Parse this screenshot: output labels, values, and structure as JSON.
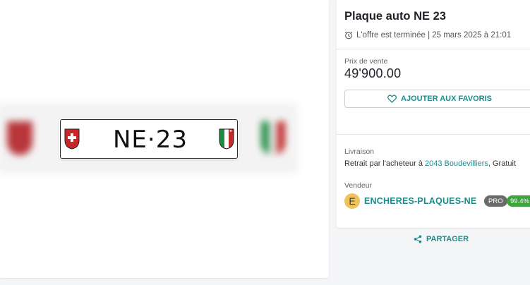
{
  "listing": {
    "plate_number": "NE·23",
    "title": "Plaque auto NE 23",
    "status": "L'offre est terminée | 25 mars 2025 à 21:01",
    "price_label": "Prix de vente",
    "price": "49'900.00",
    "favorite_label": "AJOUTER AUX FAVORIS"
  },
  "delivery": {
    "label": "Livraison",
    "text_prefix": "Retrait par l'acheteur à ",
    "location": "2043 Boudevilliers",
    "text_suffix": ", Gratuit"
  },
  "seller": {
    "label": "Vendeur",
    "initial": "E",
    "name": "ENCHERES-PLAQUES-NE",
    "pro_badge": "PRO",
    "rating": "99.4%"
  },
  "actions": {
    "share_label": "PARTAGER"
  },
  "colors": {
    "accent": "#1e8a8a",
    "rating_green": "#3da33d",
    "pro_grey": "#6b6b6b"
  }
}
